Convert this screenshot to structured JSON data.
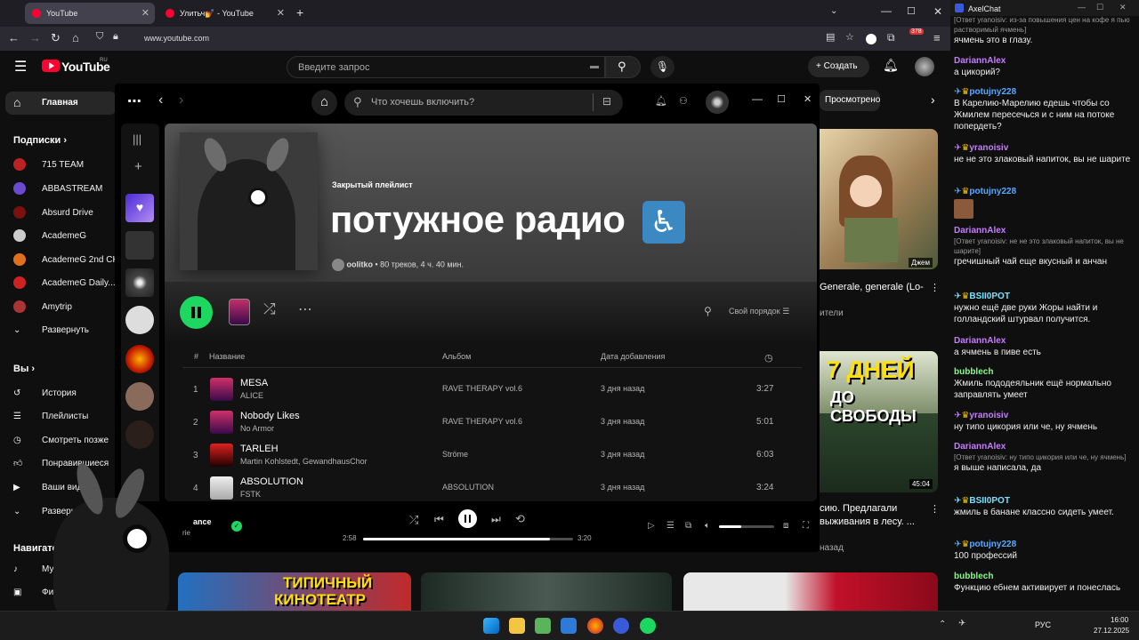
{
  "browser": {
    "tabs": [
      {
        "title": "YouTube"
      },
      {
        "title": "Улитьч💅 - YouTube"
      }
    ],
    "url": "www.youtube.com",
    "badge": "378"
  },
  "youtube": {
    "logo": "YouTube",
    "logo_region": "RU",
    "search_placeholder": "Введите запрос",
    "create_label": "Создать",
    "chip": "Просмотрено",
    "sidebar": {
      "home": "Главная",
      "subs_header": "Подписки",
      "subs": [
        "715 TEAM",
        "ABBASTREAM",
        "Absurd Drive",
        "AcademeG",
        "AcademeG 2nd CH",
        "AcademeG Daily...",
        "Amytrip"
      ],
      "expand": "Развернуть",
      "you_header": "Вы",
      "you_items": [
        "История",
        "Плейлисты",
        "Смотреть позже",
        "Понравившиеся",
        "Ваши видео",
        "Развернуть"
      ],
      "nav_header": "Навигатор",
      "nav_items": [
        "Музыка",
        "Фильмы"
      ]
    },
    "video_right": {
      "title": "Generale, generale (Lo-",
      "sub": "ители",
      "channel_hint": "Джем"
    },
    "video_right2": {
      "thumb_line1": "7 ДНЕЙ",
      "thumb_line2": "ДО СВОБОДЫ",
      "duration": "45:04",
      "title_1": "сию. Предлагали",
      "title_2": "выживания в лесу. ...",
      "meta": "назад"
    },
    "bottom_thumb": {
      "line1": "ТИПИЧНЫЙ",
      "line2": "КИНОТЕАТР"
    }
  },
  "spotify": {
    "search_placeholder": "Что хочешь включить?",
    "playlist": {
      "label": "Закрытый плейлист",
      "title": "потужное радио",
      "title_emoji": "♿",
      "owner": "oolitko",
      "meta": "• 80 треков, 4 ч. 40 мин."
    },
    "sort_label": "Свой порядок",
    "columns": {
      "num": "#",
      "title": "Название",
      "album": "Альбом",
      "added": "Дата добавления"
    },
    "tracks": [
      {
        "num": "1",
        "title": "MESA",
        "artist": "ALICE",
        "album": "RAVE THERAPY vol.6",
        "added": "3 дня назад",
        "duration": "3:27"
      },
      {
        "num": "2",
        "title": "Nobody Likes",
        "artist": "No Armor",
        "album": "RAVE THERAPY vol.6",
        "added": "3 дня назад",
        "duration": "5:01"
      },
      {
        "num": "3",
        "title": "TARLEH",
        "artist": "Martin Kohlstedt, GewandhausChor",
        "album": "Ströme",
        "added": "3 дня назад",
        "duration": "6:03"
      },
      {
        "num": "4",
        "title": "ABSOLUTION",
        "artist": "FSTK",
        "album": "ABSOLUTION",
        "added": "3 дня назад",
        "duration": "3:24"
      }
    ],
    "player": {
      "now_title": "ance",
      "now_artist": "rie",
      "elapsed": "2:58",
      "total": "3:20",
      "progress": 0.89,
      "volume": 0.4
    }
  },
  "chat": {
    "title": "AxelChat",
    "messages": [
      {
        "nick": "",
        "reply": "[Ответ yranoisiv: из-за повышения цен на кофе я пью растворимый ячмень]",
        "text": "ячмень это в глазу."
      },
      {
        "nick": "DariannAlex",
        "color": "#c77dff",
        "text": "а цикорий?"
      },
      {
        "nick": "potujny228",
        "color": "#5aa9ff",
        "text": "В Карелию-Марелию едешь чтобы со Жмилем пересечься и с ним на потоке попердеть?"
      },
      {
        "nick": "yranoisiv",
        "color": "#c77dff",
        "text": "не не это злаковый напиток, вы не шарите"
      },
      {
        "nick": "potujny228",
        "color": "#5aa9ff",
        "text": ""
      },
      {
        "nick": "DariannAlex",
        "color": "#c77dff",
        "reply": "[Ответ yranoisiv: не не это злаковый напиток, вы не шарите]",
        "text": "гречишный чай еще вкусный и анчан"
      },
      {
        "nick": "BSII0POT",
        "color": "#7ae0ff",
        "text": "нужно ещё две руки Жоры найти и голландский штурвал получится."
      },
      {
        "nick": "DariannAlex",
        "color": "#c77dff",
        "text": "а ячмень в пиве есть"
      },
      {
        "nick": "bubblech",
        "color": "#7fff7f",
        "text": "Жмиль пододеяльник ещё нормально заправлять умеет"
      },
      {
        "nick": "yranoisiv",
        "color": "#c77dff",
        "text": "ну типо цикория или че, ну ячмень"
      },
      {
        "nick": "DariannAlex",
        "color": "#c77dff",
        "reply": "[Ответ yranoisiv: ну типо цикория или че, ну ячмень]",
        "text": "я выше написала, да"
      },
      {
        "nick": "BSII0POT",
        "color": "#7ae0ff",
        "text": "жмиль в банане классно сидеть умеет."
      },
      {
        "nick": "potujny228",
        "color": "#5aa9ff",
        "text": "100 профессий"
      },
      {
        "nick": "bubblech",
        "color": "#7fff7f",
        "text": "Функцию ебнем активирует и понеслась"
      }
    ]
  },
  "taskbar": {
    "lang": "РУС",
    "time": "16:00",
    "date": "27.12.2025"
  }
}
